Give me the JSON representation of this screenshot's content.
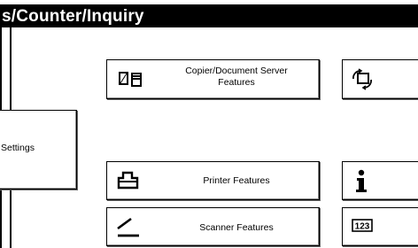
{
  "header": {
    "title": "s/Counter/Inquiry"
  },
  "buttons": {
    "settings_label": "Settings",
    "copier_label_line1": "Copier/Document Server",
    "copier_label_line2": "Features",
    "printer_label": "Printer Features",
    "scanner_label": "Scanner Features"
  },
  "icons": {
    "copier": "copier-document-server-icon",
    "printer": "printer-icon",
    "scanner": "scanner-icon",
    "right_top": "counter-icon",
    "right_middle": "info-icon",
    "right_bottom": "counter-123-icon"
  },
  "colors": {
    "title_background": "#000000",
    "title_text": "#ffffff",
    "page_background": "#ffffff"
  }
}
